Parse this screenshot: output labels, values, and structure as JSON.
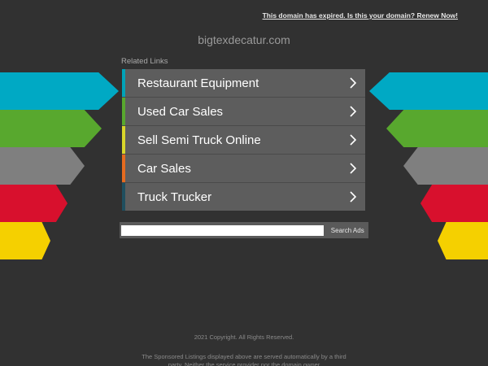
{
  "header": {
    "expired_notice": "This domain has expired. Is this your domain? Renew Now!",
    "domain": "bigtexdecatur.com"
  },
  "related": {
    "label": "Related Links",
    "items": [
      {
        "label": "Restaurant Equipment",
        "color": "#00a3b8"
      },
      {
        "label": "Used Car Sales",
        "color": "#58a82e"
      },
      {
        "label": "Sell Semi Truck Online",
        "color": "#d8d62a"
      },
      {
        "label": "Car Sales",
        "color": "#e56b1f"
      },
      {
        "label": "Truck Trucker",
        "color": "#1f4f5f"
      }
    ]
  },
  "arrows": {
    "colors": [
      "#00a9c4",
      "#58a82e",
      "#7f7f7f",
      "#d8102d",
      "#f5d000"
    ]
  },
  "search": {
    "placeholder": "",
    "button_label": "Search Ads"
  },
  "footer": {
    "copyright": "2021 Copyright. All Rights Reserved.",
    "disclaimer": "The Sponsored Listings displayed above are served automatically by a third party. Neither the service provider nor the domain owner"
  }
}
